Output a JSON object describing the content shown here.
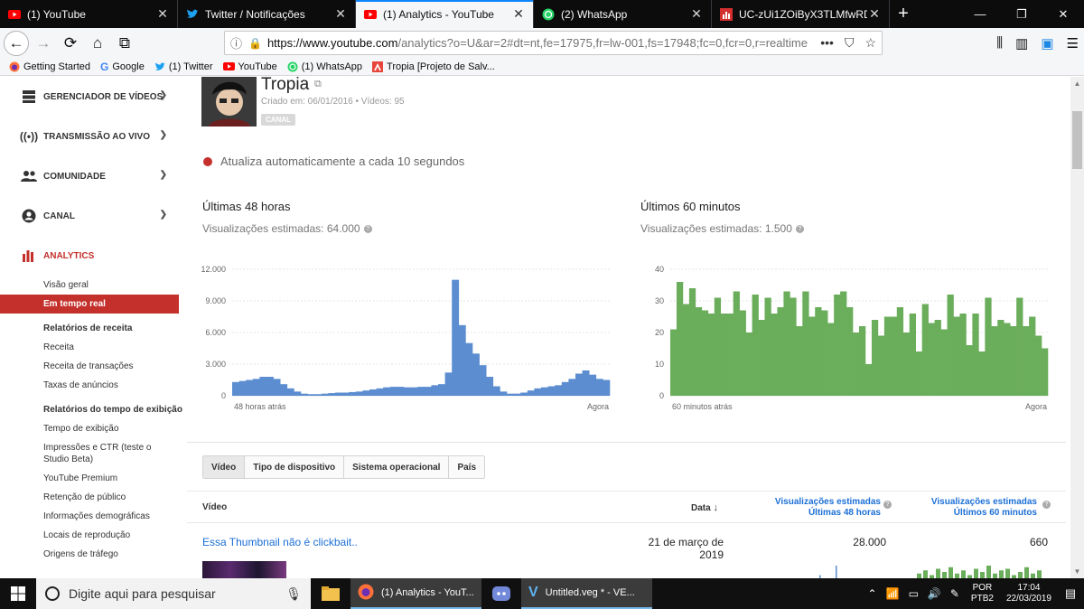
{
  "browser": {
    "tabs": [
      {
        "label": "(1) YouTube",
        "icon": "youtube-icon",
        "active": false
      },
      {
        "label": "Twitter / Notificações",
        "icon": "twitter-icon",
        "active": false
      },
      {
        "label": "(1) Analytics - YouTube",
        "icon": "youtube-icon",
        "active": true
      },
      {
        "label": "(2) WhatsApp",
        "icon": "whatsapp-icon",
        "active": false
      },
      {
        "label": "UC-zUi1ZOiByX3TLMfwRDPWw",
        "icon": "analytics-icon",
        "active": false
      }
    ],
    "url_domain": "https://www.youtube.com",
    "url_path": "/analytics?o=U&ar=2#dt=nt,fe=17975,fr=lw-001,fs=17948;fc=0,fcr=0,r=realtime",
    "bookmarks": [
      {
        "label": "Getting Started",
        "icon": "firefox-icon"
      },
      {
        "label": "Google",
        "icon": "google-icon"
      },
      {
        "label": "(1) Twitter",
        "icon": "twitter-icon"
      },
      {
        "label": "YouTube",
        "icon": "youtube-icon"
      },
      {
        "label": "(1) WhatsApp",
        "icon": "whatsapp-icon"
      },
      {
        "label": "Tropia [Projeto de Salv...",
        "icon": "adobe-icon"
      }
    ]
  },
  "sidebar": {
    "sections": [
      {
        "label": "GERENCIADOR DE VÍDEOS",
        "icon": "video-manager-icon"
      },
      {
        "label": "TRANSMISSÃO AO VIVO",
        "icon": "live-broadcast-icon"
      },
      {
        "label": "COMUNIDADE",
        "icon": "community-icon"
      },
      {
        "label": "CANAL",
        "icon": "channel-icon"
      }
    ],
    "analytics_label": "ANALYTICS",
    "items": [
      {
        "label": "Visão geral",
        "type": "item"
      },
      {
        "label": "Em tempo real",
        "type": "active"
      },
      {
        "label": "Relatórios de receita",
        "type": "head"
      },
      {
        "label": "Receita",
        "type": "item"
      },
      {
        "label": "Receita de transações",
        "type": "item"
      },
      {
        "label": "Taxas de anúncios",
        "type": "item"
      },
      {
        "label": "Relatórios do tempo de exibição",
        "type": "head"
      },
      {
        "label": "Tempo de exibição",
        "type": "item"
      },
      {
        "label": "Impressões e CTR (teste o Studio Beta)",
        "type": "two"
      },
      {
        "label": "YouTube Premium",
        "type": "item"
      },
      {
        "label": "Retenção de público",
        "type": "item"
      },
      {
        "label": "Informações demográficas",
        "type": "item"
      },
      {
        "label": "Locais de reprodução",
        "type": "item"
      },
      {
        "label": "Origens de tráfego",
        "type": "item"
      }
    ]
  },
  "channel": {
    "name": "Tropia",
    "meta": "Criado em: 06/01/2016  •  Vídeos: 95",
    "badge": "CANAL"
  },
  "live_note": "Atualiza automaticamente a cada 10 segundos",
  "panel48": {
    "title": "Últimas 48 horas",
    "subtitle": "Visualizações estimadas: 64.000"
  },
  "panel60": {
    "title": "Últimos 60 minutos",
    "subtitle": "Visualizações estimadas: 1.500"
  },
  "report_tabs": [
    "Vídeo",
    "Tipo de dispositivo",
    "Sistema operacional",
    "País"
  ],
  "table": {
    "col_video": "Vídeo",
    "col_date": "Data",
    "col_48": [
      "Visualizações estimadas",
      "Últimas 48 horas"
    ],
    "col_60": [
      "Visualizações estimadas",
      "Últimos 60 minutos"
    ],
    "rows": [
      {
        "title": "Essa Thumbnail não é clickbait..",
        "date": "21 de março de 2019",
        "views48": "28.000",
        "views60": "660"
      }
    ]
  },
  "taskbar": {
    "search_placeholder": "Digite aqui para pesquisar",
    "apps": [
      "(1) Analytics - YouT...",
      "Untitled.veg * - VE..."
    ],
    "lang": [
      "POR",
      "PTB2"
    ],
    "time": "17:04",
    "date": "22/03/2019"
  },
  "colors": {
    "accent": "#c4302b",
    "bar48": "#5b8dd0",
    "bar60": "#6aad5a",
    "link": "#1c6fd6"
  },
  "chart_data": [
    {
      "type": "bar",
      "title": "Últimas 48 horas",
      "ylim": [
        0,
        12000
      ],
      "yticks": [
        "12.000",
        "9.000",
        "6.000",
        "3.000",
        "0"
      ],
      "yticks_values": [
        12000,
        9000,
        6000,
        3000,
        0
      ],
      "xlabels": [
        "48 horas atrás",
        "Agora"
      ],
      "values": [
        1300,
        1400,
        1500,
        1600,
        1800,
        1800,
        1600,
        1100,
        700,
        400,
        200,
        150,
        150,
        200,
        250,
        300,
        300,
        350,
        400,
        500,
        600,
        700,
        800,
        850,
        850,
        800,
        800,
        850,
        850,
        1000,
        1100,
        2200,
        11000,
        6700,
        5000,
        4000,
        2900,
        1800,
        900,
        400,
        200,
        200,
        300,
        500,
        700,
        800,
        900,
        1000,
        1300,
        1600,
        2100,
        2400,
        2000,
        1600,
        1500
      ]
    },
    {
      "type": "bar",
      "title": "Últimos 60 minutos",
      "ylim": [
        0,
        40
      ],
      "yticks": [
        "40",
        "30",
        "20",
        "10",
        "0"
      ],
      "yticks_values": [
        40,
        30,
        20,
        10,
        0
      ],
      "xlabels": [
        "60 minutos atrás",
        "Agora"
      ],
      "values": [
        21,
        36,
        29,
        34,
        28,
        27,
        26,
        31,
        26,
        26,
        33,
        27,
        20,
        32,
        24,
        31,
        26,
        28,
        33,
        31,
        22,
        33,
        25,
        28,
        27,
        23,
        32,
        33,
        28,
        20,
        22,
        10,
        24,
        19,
        25,
        25,
        28,
        20,
        26,
        14,
        29,
        23,
        24,
        21,
        32,
        25,
        26,
        16,
        26,
        14,
        31,
        22,
        24,
        23,
        22,
        31,
        22,
        25,
        19,
        15
      ]
    }
  ],
  "sparks": {
    "v48": [
      2,
      0,
      0,
      0,
      0,
      0,
      0,
      0,
      0,
      8
    ],
    "v60": [
      3,
      5,
      2,
      6,
      4,
      7,
      3,
      5,
      2,
      6,
      4,
      8,
      3,
      5,
      6,
      2,
      4,
      7,
      3,
      5
    ]
  }
}
